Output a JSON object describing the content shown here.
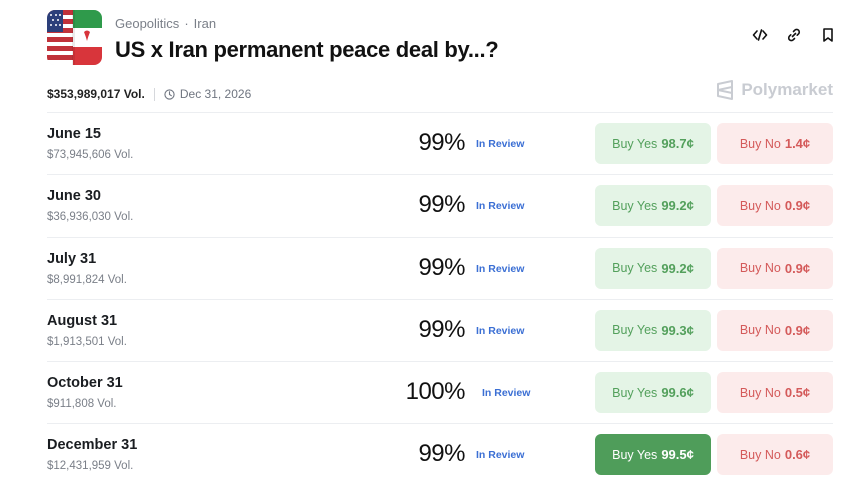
{
  "header": {
    "category": "Geopolitics",
    "separator": "·",
    "subcategory": "Iran",
    "title": "US x Iran permanent peace deal by...?"
  },
  "meta": {
    "volume": "$353,989,017 Vol.",
    "end_date": "Dec 31, 2026"
  },
  "brand": {
    "name": "Polymarket"
  },
  "colors": {
    "yes_bg": "#e4f4e6",
    "yes_text": "#53a05c",
    "yes_active_bg": "#4f9d5a",
    "no_bg": "#fcebeb",
    "no_text": "#d45a5a",
    "review": "#3b6fd4"
  },
  "icons": [
    "embed-icon",
    "link-icon",
    "bookmark-icon",
    "clock-icon",
    "polymarket-logo-icon"
  ],
  "rows": [
    {
      "name": "June 15",
      "volume": "$73,945,606 Vol.",
      "chance": "99%",
      "status": "In Review",
      "yes_label": "Buy Yes",
      "yes_price": "98.7¢",
      "no_label": "Buy No",
      "no_price": "1.4¢"
    },
    {
      "name": "June 30",
      "volume": "$36,936,030 Vol.",
      "chance": "99%",
      "status": "In Review",
      "yes_label": "Buy Yes",
      "yes_price": "99.2¢",
      "no_label": "Buy No",
      "no_price": "0.9¢"
    },
    {
      "name": "July 31",
      "volume": "$8,991,824 Vol.",
      "chance": "99%",
      "status": "In Review",
      "yes_label": "Buy Yes",
      "yes_price": "99.2¢",
      "no_label": "Buy No",
      "no_price": "0.9¢"
    },
    {
      "name": "August 31",
      "volume": "$1,913,501 Vol.",
      "chance": "99%",
      "status": "In Review",
      "yes_label": "Buy Yes",
      "yes_price": "99.3¢",
      "no_label": "Buy No",
      "no_price": "0.9¢"
    },
    {
      "name": "October 31",
      "volume": "$911,808 Vol.",
      "chance": "100%",
      "status": "In Review",
      "yes_label": "Buy Yes",
      "yes_price": "99.6¢",
      "no_label": "Buy No",
      "no_price": "0.5¢"
    },
    {
      "name": "December 31",
      "volume": "$12,431,959 Vol.",
      "chance": "99%",
      "status": "In Review",
      "yes_label": "Buy Yes",
      "yes_price": "99.5¢",
      "no_label": "Buy No",
      "no_price": "0.6¢"
    }
  ]
}
